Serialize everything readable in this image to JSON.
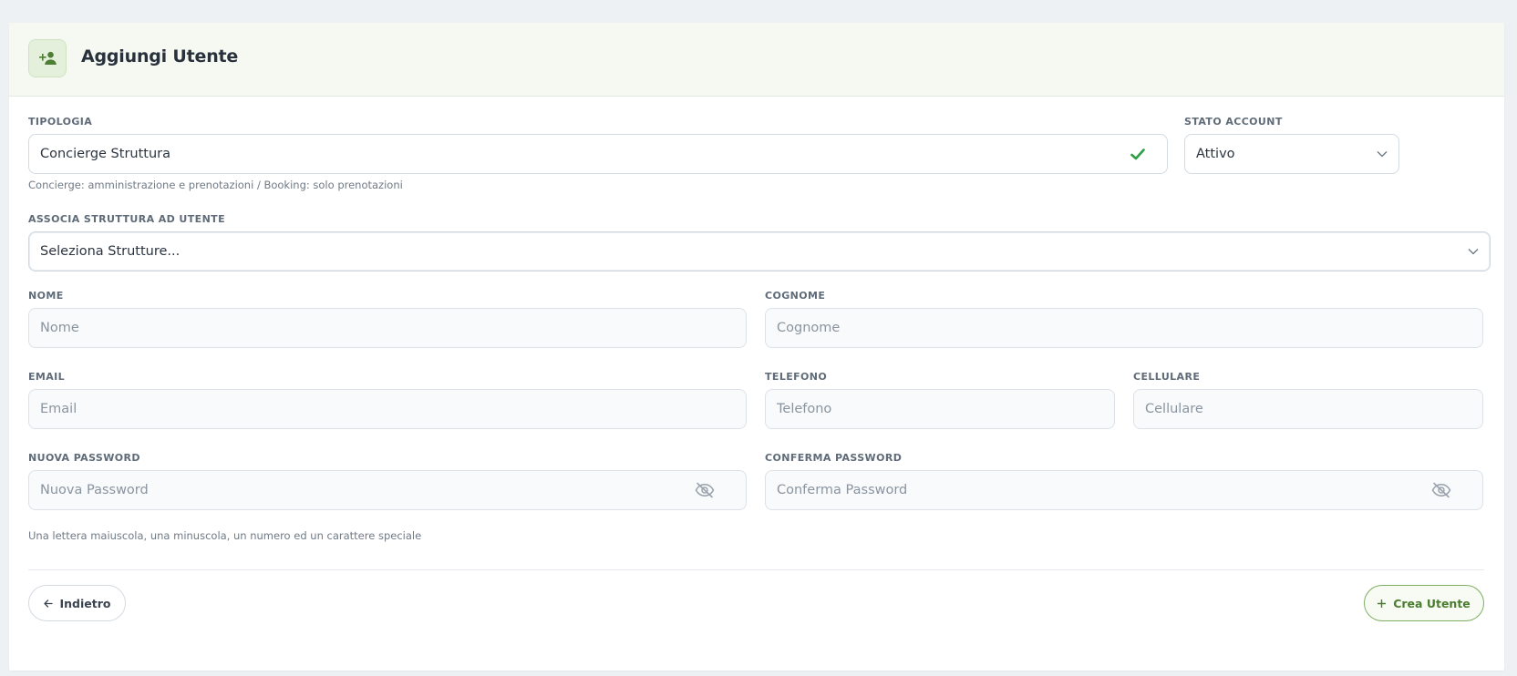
{
  "header": {
    "title": "Aggiungi Utente",
    "icon": "person-add-icon"
  },
  "form": {
    "tipologia": {
      "label": "TIPOLOGIA",
      "value": "Concierge Struttura",
      "hint": "Concierge: amministrazione e prenotazioni / Booking: solo prenotazioni"
    },
    "stato_account": {
      "label": "STATO ACCOUNT",
      "value": "Attivo"
    },
    "strutture": {
      "label": "ASSOCIA STRUTTURA AD UTENTE",
      "placeholder": "Seleziona Strutture..."
    },
    "nome": {
      "label": "NOME",
      "placeholder": "Nome"
    },
    "cognome": {
      "label": "COGNOME",
      "placeholder": "Cognome"
    },
    "email": {
      "label": "EMAIL",
      "placeholder": "Email"
    },
    "telefono": {
      "label": "TELEFONO",
      "placeholder": "Telefono"
    },
    "cellulare": {
      "label": "CELLULARE",
      "placeholder": "Cellulare"
    },
    "nuova_password": {
      "label": "NUOVA PASSWORD",
      "placeholder": "Nuova Password",
      "hint": "Una lettera maiuscola, una minuscola, un numero ed un carattere speciale"
    },
    "conferma_password": {
      "label": "CONFERMA PASSWORD",
      "placeholder": "Conferma Password"
    }
  },
  "actions": {
    "back_label": "Indietro",
    "create_label": "Crea Utente"
  },
  "colors": {
    "accent": "#4a7d2e",
    "valid_check": "#2e9e44"
  }
}
